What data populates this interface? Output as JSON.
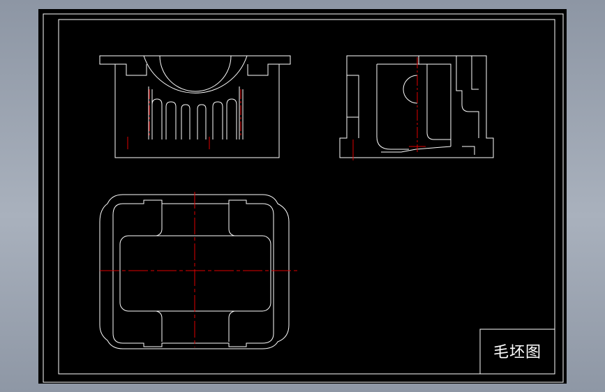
{
  "title_block": {
    "drawing_name": "毛坯图"
  },
  "colors": {
    "background": "#000000",
    "outline": "#ffffff",
    "centerline": "#e00000",
    "desktop": "#9aa3b0"
  }
}
